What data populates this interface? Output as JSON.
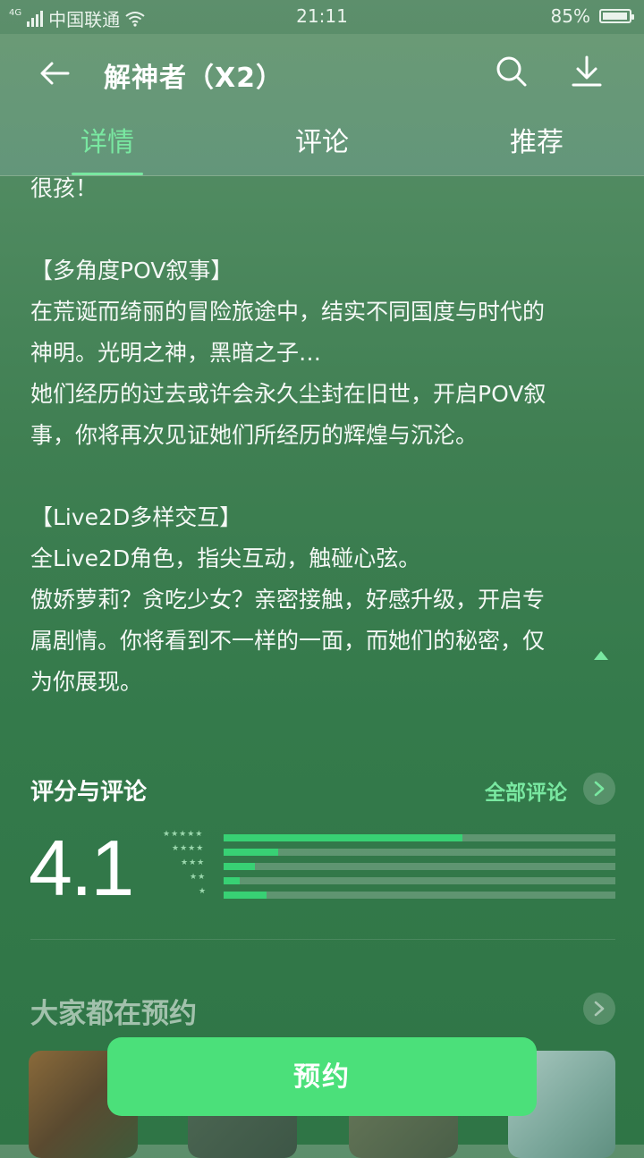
{
  "status_bar": {
    "network": "4G",
    "carrier": "中国联通",
    "time": "21:11",
    "battery": "85%",
    "battery_level": 0.85
  },
  "header": {
    "back_icon": "arrow-left-icon",
    "title": "解神者（X2）",
    "search_icon": "search-icon",
    "download_icon": "download-icon"
  },
  "tabs": [
    {
      "label": "详情",
      "active": true
    },
    {
      "label": "评论",
      "active": false
    },
    {
      "label": "推荐",
      "active": false
    }
  ],
  "description": {
    "cut_line": "很孩！",
    "paragraphs": [
      {
        "heading": "【多角度POV叙事】",
        "lines": [
          "在荒诞而绮丽的冒险旅途中，结实不同国度与时代的",
          "神明。光明之神，黑暗之子…",
          "她们经历的过去或许会永久尘封在旧世，开启POV叙",
          "事，你将再次见证她们所经历的辉煌与沉沦。"
        ]
      },
      {
        "heading": "【Live2D多样交互】",
        "lines": [
          "全Live2D角色，指尖互动，触碰心弦。",
          "傲娇萝莉？贪吃少女？亲密接触，好感升级，开启专",
          "属剧情。你将看到不一样的一面，而她们的秘密，仅",
          "为你展现。"
        ]
      }
    ],
    "collapse_icon": "caret-up-icon"
  },
  "ratings": {
    "heading": "评分与评论",
    "all_reviews_label": "全部评论",
    "score": "4.1",
    "distribution": [
      {
        "stars": "★★★★★",
        "fraction": 0.61
      },
      {
        "stars": "★★★★",
        "fraction": 0.14
      },
      {
        "stars": "★★★",
        "fraction": 0.08
      },
      {
        "stars": "★★",
        "fraction": 0.04
      },
      {
        "stars": "★",
        "fraction": 0.11
      }
    ],
    "accent_color": "#38d174"
  },
  "recommend": {
    "heading": "大家都在预约",
    "items": [
      {
        "name": "game-thumbnail-1"
      },
      {
        "name": "game-thumbnail-2"
      },
      {
        "name": "game-thumbnail-3"
      },
      {
        "name": "game-thumbnail-4"
      }
    ]
  },
  "action": {
    "reserve_label": "预约",
    "button_color": "#4be07a"
  }
}
